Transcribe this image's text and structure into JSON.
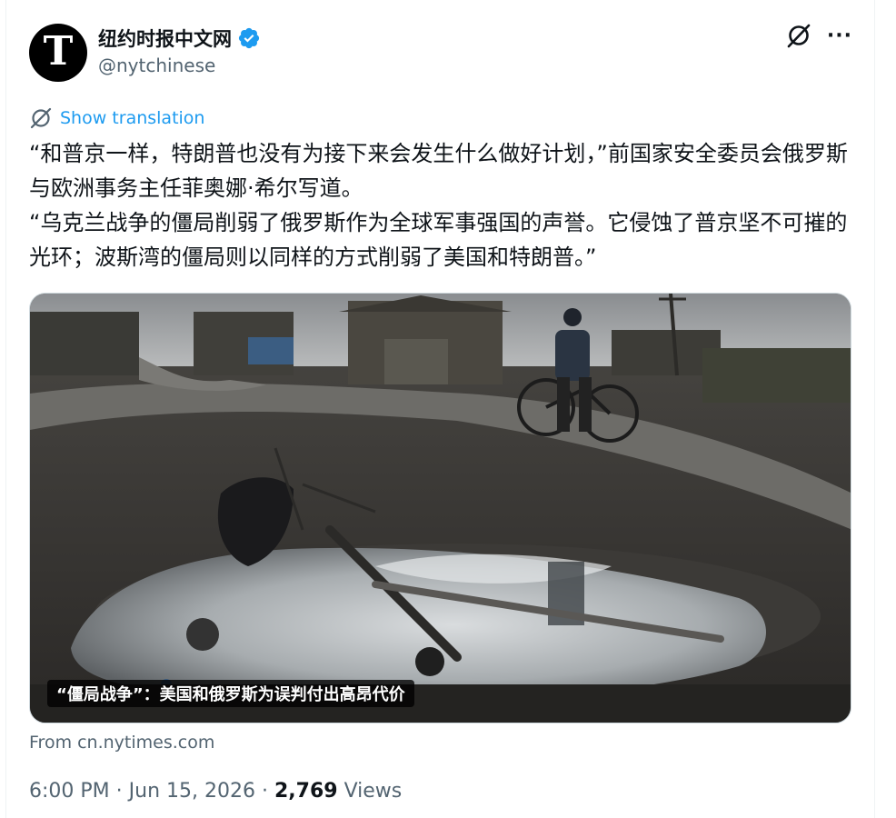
{
  "author": {
    "display_name": "纽约时报中文网",
    "handle": "@nytchinese",
    "avatar_letter": "T",
    "verified_color": "#1d9bf0"
  },
  "actions": {
    "grok_icon": "grok-slash-icon",
    "more_icon": "ellipsis-icon",
    "more_label": "···"
  },
  "translation": {
    "label": "Show translation",
    "icon": "translate-icon"
  },
  "tweet": {
    "line1": "“和普京一样，特朗普也没有为接下来会发生什么做好计划，”前国家安全委员会俄罗斯与欧洲事务主任菲奥娜·希尔写道。",
    "line2": "“乌克兰战争的僵局削弱了俄罗斯作为全球军事强国的声誉。它侵蚀了普京坚不可摧的光环；波斯湾的僵局则以同样的方式削弱了美国和特朗普。”"
  },
  "media": {
    "caption": "“僵局战争”：美国和俄罗斯为误判付出高昂代价"
  },
  "link_source": "From cn.nytimes.com",
  "meta": {
    "time": "6:00 PM",
    "separator": "·",
    "date": "Jun 15, 2026",
    "views_count": "2,769",
    "views_label": "Views"
  },
  "colors": {
    "accent": "#1d9bf0",
    "secondary_text": "#536471",
    "primary_text": "#0f1419"
  }
}
